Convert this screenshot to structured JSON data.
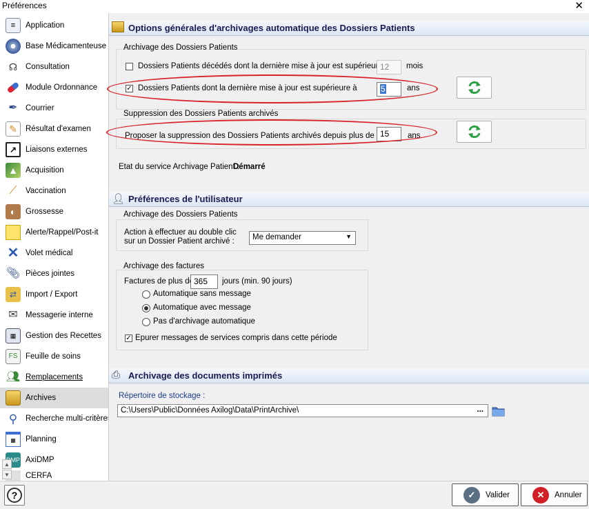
{
  "window": {
    "title": "Préférences"
  },
  "sidebar": {
    "items": [
      {
        "label": "Application",
        "icon": "notepad-icon"
      },
      {
        "label": "Base Médicamenteuse",
        "icon": "disc-icon"
      },
      {
        "label": "Consultation",
        "icon": "stethoscope-icon"
      },
      {
        "label": "Module Ordonnance",
        "icon": "pill-icon"
      },
      {
        "label": "Courrier",
        "icon": "pen-icon"
      },
      {
        "label": "Résultat d'examen",
        "icon": "report-icon"
      },
      {
        "label": "Liaisons externes",
        "icon": "external-link-icon"
      },
      {
        "label": "Acquisition",
        "icon": "acquisition-icon"
      },
      {
        "label": "Vaccination",
        "icon": "syringe-icon"
      },
      {
        "label": "Grossesse",
        "icon": "pregnancy-icon"
      },
      {
        "label": "Alerte/Rappel/Post-it",
        "icon": "sticky-note-icon"
      },
      {
        "label": "Volet médical",
        "icon": "cross-icon"
      },
      {
        "label": "Pièces jointes",
        "icon": "paperclip-icon"
      },
      {
        "label": "Import / Export",
        "icon": "import-export-icon"
      },
      {
        "label": "Messagerie interne",
        "icon": "envelope-icon"
      },
      {
        "label": "Gestion des Recettes",
        "icon": "calculator-icon"
      },
      {
        "label": "Feuille de soins",
        "icon": "care-sheet-icon"
      },
      {
        "label": "Remplacements",
        "icon": "people-icon"
      },
      {
        "label": "Archives",
        "icon": "archive-icon"
      },
      {
        "label": "Recherche multi-critères",
        "icon": "magnifier-icon"
      },
      {
        "label": "Planning",
        "icon": "calendar-icon"
      },
      {
        "label": "AxiDMP",
        "icon": "dmp-icon"
      },
      {
        "label": "CERFA",
        "icon": "cerfa-icon"
      }
    ],
    "selected": "Archives"
  },
  "section1": {
    "title": "Options générales d'archivages automatique des Dossiers Patients",
    "group_archivage": {
      "title": "Archivage des Dossiers Patients",
      "deceased": {
        "label": "Dossiers Patients décédés dont la dernière mise à jour est supérieure à",
        "checked": false,
        "value": "12",
        "unit": "mois"
      },
      "updated": {
        "label": "Dossiers Patients dont la dernière mise à jour est supérieure à",
        "checked": true,
        "value": "5",
        "unit": "ans"
      }
    },
    "group_suppression": {
      "title": "Suppression des Dossiers Patients archivés",
      "label": "Proposer la suppression des Dossiers Patients archivés depuis plus de",
      "value": "15",
      "unit": "ans"
    },
    "service_status_label": "Etat du service Archivage Patient :",
    "service_status_value": "Démarré"
  },
  "section2": {
    "title": "Préférences de l'utilisateur",
    "group_dossiers": {
      "title": "Archivage des Dossiers Patients",
      "action_label_line1": "Action à effectuer au double clic",
      "action_label_line2": "sur un Dossier Patient archivé :",
      "action_value": "Me demander"
    },
    "group_factures": {
      "title": "Archivage des factures",
      "prefix": "Factures de plus de",
      "days_value": "365",
      "suffix": "jours (min. 90 jours)",
      "radios": [
        {
          "label": "Automatique sans message",
          "checked": false
        },
        {
          "label": "Automatique avec message",
          "checked": true
        },
        {
          "label": "Pas d'archivage automatique",
          "checked": false
        }
      ],
      "purge": {
        "label": "Epurer messages de services compris dans cette période",
        "checked": true
      }
    }
  },
  "section3": {
    "title": "Archivage des documents imprimés",
    "storage_label": "Répertoire de stockage :",
    "storage_path": "C:\\Users\\Public\\Données Axilog\\Data\\PrintArchive\\",
    "browse_label": "..."
  },
  "footer": {
    "help": "?",
    "validate": "Valider",
    "cancel": "Annuler"
  },
  "colors": {
    "highlight_ellipse": "#d8232a",
    "refresh_green": "#2ea043",
    "validate_icon": "#5b6f83",
    "cancel_icon": "#d01f26"
  }
}
